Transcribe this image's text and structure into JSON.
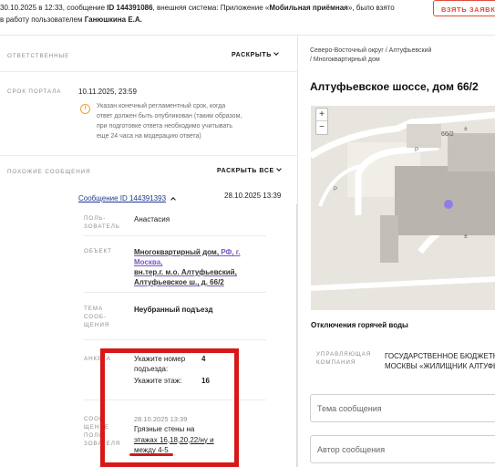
{
  "header": {
    "text_prefix": "30.10.2025 в 12:33, сообщение ",
    "message_id": "ID 144391086",
    "text_mid": ", внешняя система: Приложение «",
    "system": "Мобильная приёмная",
    "text_suffix": "», было взято",
    "line2_prefix": "в работу пользователем ",
    "user": "Ганюшкина Е.А.",
    "take_button": "ВЗЯТЬ ЗАЯВКУ"
  },
  "sections": {
    "responsible": {
      "label": "ОТВЕТСТВЕННЫЕ",
      "toggle": "РАСКРЫТЬ"
    },
    "portal_deadline": {
      "label": "СРОК ПОРТАЛА",
      "value": "10.11.2025, 23:59",
      "icon": "info-icon",
      "warning_lines": [
        "Указан конечный регламентный срок, когда",
        "ответ должен быть опубликован (таким образом,",
        "при подготовке ответа необходимо учитывать",
        "еще 24 часа на модерацию ответа)"
      ]
    },
    "similar": {
      "label": "ПОХОЖИЕ СООБЩЕНИЯ",
      "toggle": "РАСКРЫТЬ ВСЕ"
    }
  },
  "similar_message": {
    "link": "Сообщение ID 144391393",
    "date": "28.10.2025 13:39",
    "user_label_1": "ПОЛЬ-",
    "user_label_2": "ЗОВАТЕЛЬ",
    "user_value": "Анастасия",
    "object_label": "ОБЪЕКТ",
    "object_line1_a": "Многоквартирный дом, ",
    "object_line1_b": "РФ, г. Москва,",
    "object_line2": "вн.тер.г. м.о. Алтуфьевский,",
    "object_line3": "Алтуфьевское ш., д. 66/2",
    "topic_label_1": "ТЕМА",
    "topic_label_2": "СООБ-",
    "topic_label_3": "ЩЕНИЯ",
    "topic_value": "Неубранный подъезд",
    "survey_label": "АНКЕТА",
    "entrance_label_1": "Укажите номер",
    "entrance_label_2": "подъезда:",
    "entrance_value": "4",
    "floor_label": "Укажите этаж:",
    "floor_value": "16",
    "msg_label_1": "СООБ-",
    "msg_label_2": "ЩЕНИЕ",
    "msg_label_3": "ПОЛЬ-",
    "msg_label_4": "ЗОВАТЕЛЯ",
    "msg_date": "28.10.2025 13:39",
    "msg_line1": "Грязные стены на",
    "msg_line2": "этажах 16,18,20,22/ну и",
    "msg_line3": "между 4-5"
  },
  "right": {
    "breadcrumb_1": "Северо-Восточный округ / Алтуфьевский",
    "breadcrumb_2": "/ Многоквартирный дом",
    "title": "Алтуфьевское шоссе, дом 66/2",
    "map_house_label": "66/2",
    "map_parking_label": "P",
    "zoom_in": "+",
    "zoom_out": "−",
    "topic": "Отключения горячей воды",
    "company_label_1": "УПРАВЛЯЮЩАЯ",
    "company_label_2": "КОМПАНИЯ",
    "company_value_1": "ГОСУДАРСТВЕННОЕ БЮДЖЕТНОЕ",
    "company_value_2": "МОСКВЫ «ЖИЛИЩНИК АЛТУФЬЕВ",
    "topic_placeholder": "Тема сообщения",
    "author_placeholder": "Автор сообщения"
  },
  "colors": {
    "accent_red": "#e24a3b",
    "link_blue": "#1d3a8c",
    "purple": "#7d57c2",
    "warning_orange": "#f0a23a",
    "annotation_red": "#d81818"
  }
}
